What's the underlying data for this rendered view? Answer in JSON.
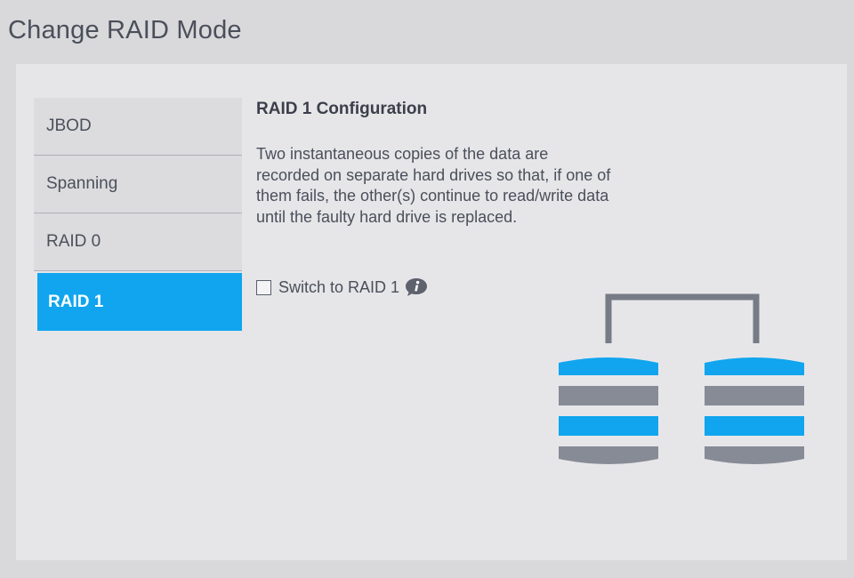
{
  "page": {
    "title": "Change RAID Mode"
  },
  "modes": [
    {
      "label": "JBOD",
      "active": false
    },
    {
      "label": "Spanning",
      "active": false
    },
    {
      "label": "RAID 0",
      "active": false
    },
    {
      "label": "RAID 1",
      "active": true
    }
  ],
  "config": {
    "title": "RAID 1 Configuration",
    "description": "Two instantaneous copies of the data are recorded on separate hard drives so that, if one of them fails, the other(s) continue to read/write data until the faulty hard drive is replaced.",
    "switch_label": "Switch to RAID 1",
    "switch_checked": false
  },
  "icons": {
    "info": "info-icon",
    "diagram": "raid1-mirror-diagram"
  },
  "colors": {
    "accent": "#10a5ee",
    "drive_gray": "#868b95",
    "connector": "#767b85"
  }
}
